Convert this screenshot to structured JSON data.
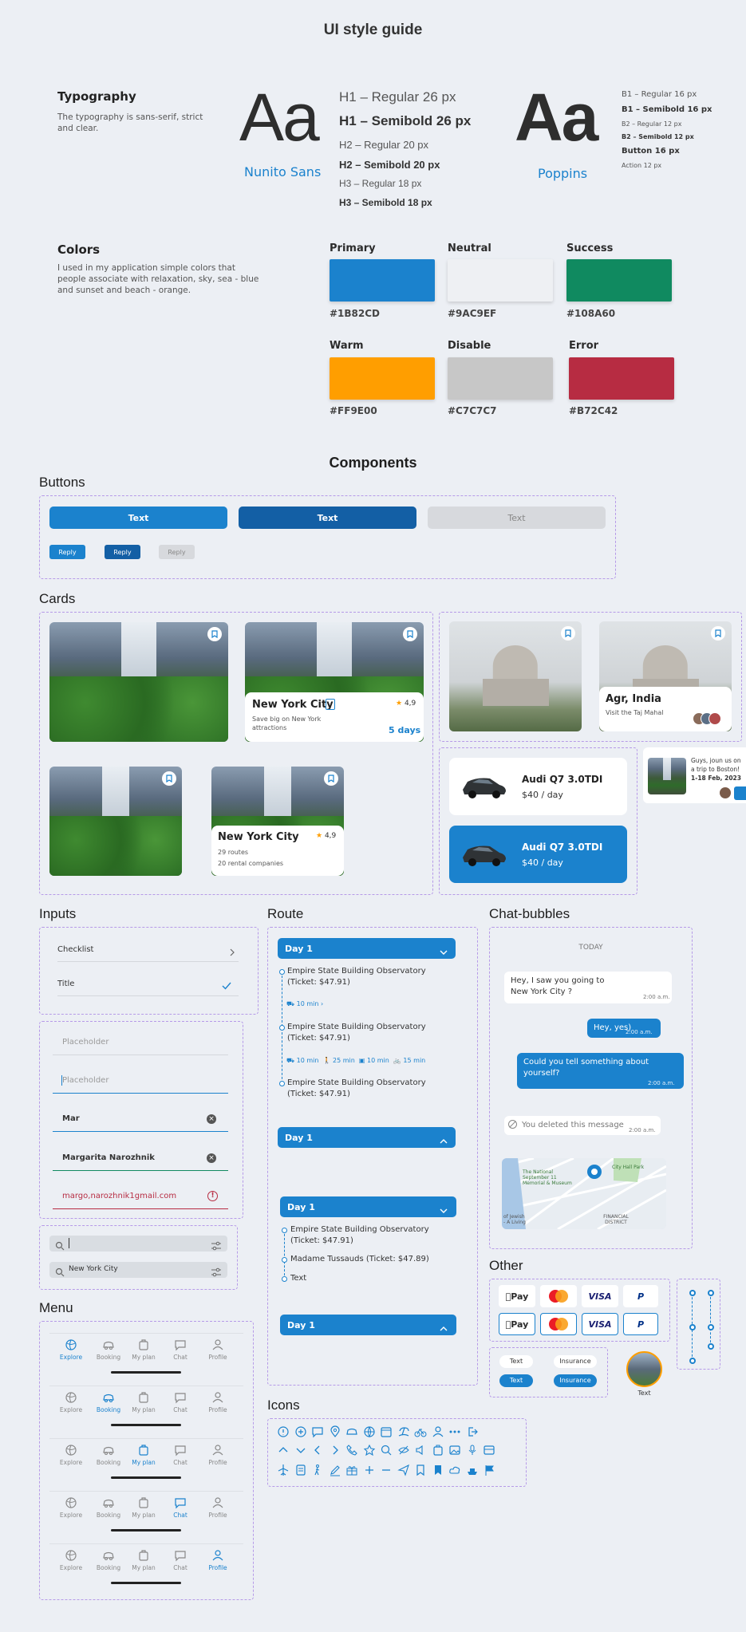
{
  "page_title": "UI style guide",
  "typography": {
    "heading": "Typography",
    "description": "The typography is sans-serif, strict and clear.",
    "sample": "Aa",
    "font1": {
      "name": "Nunito Sans",
      "styles": [
        "H1 – Regular 26 px",
        "H1 – Semibold 26 px",
        "H2 – Regular 20 px",
        "H2 – Semibold 20 px",
        "H3 – Regular 18 px",
        "H3 – Semibold 18 px"
      ]
    },
    "font2": {
      "name": "Poppins",
      "styles": [
        "B1 – Regular 16 px",
        "B1 – Semibold 16 px",
        "B2 – Regular 12 px",
        "B2 – Semibold 12 px",
        "Button 16 px",
        "Action 12 px"
      ]
    }
  },
  "colors": {
    "heading": "Colors",
    "description": "I used in my application simple colors that people associate with relaxation, sky, sea - blue and sunset and beach - orange.",
    "swatches": [
      {
        "label": "Primary",
        "hex": "#1B82CD"
      },
      {
        "label": "Neutral",
        "hex": "#9AC9EF"
      },
      {
        "label": "Success",
        "hex": "#108A60"
      },
      {
        "label": "Warm",
        "hex": "#FF9E00"
      },
      {
        "label": "Disable",
        "hex": "#C7C7C7"
      },
      {
        "label": "Error",
        "hex": "#B72C42"
      }
    ]
  },
  "components_heading": "Components",
  "buttons": {
    "heading": "Buttons",
    "large": [
      "Text",
      "Text",
      "Text"
    ],
    "small": [
      "Reply",
      "Reply",
      "Reply"
    ]
  },
  "cards": {
    "heading": "Cards",
    "nyc1": {
      "title": "New York City",
      "desc": "Save big on New York attractions",
      "rating": "4,9",
      "days": "5 days"
    },
    "nyc2": {
      "title": "New York City",
      "line1": "29 routes",
      "line2": "20 rental companies",
      "rating": "4,9"
    },
    "india": {
      "title": "Agr, India",
      "desc": "Visit the Taj Mahal"
    },
    "car1": {
      "title": "Audi Q7 3.0TDI",
      "price": "$40 / day"
    },
    "car2": {
      "title": "Audi Q7 3.0TDI",
      "price": "$40 / day"
    },
    "boston": {
      "text": "Guys, joun us on a trip to Boston!",
      "date": "1-18 Feb, 2023"
    }
  },
  "inputs": {
    "heading": "Inputs",
    "checklist": "Checklist",
    "title": "Title",
    "placeholder1": "Placeholder",
    "placeholder2": "Placeholder",
    "typing": "Mar",
    "filled": "Margarita Narozhnik",
    "error": "margo,narozhnik1gmail.com",
    "search_value": "New York City"
  },
  "route": {
    "heading": "Route",
    "day_label": "Day 1",
    "place1": "Empire State Building Observatory (Ticket: $47.91)",
    "place2": "Empire State Building Observatory (Ticket: $47.91)",
    "place3": "Empire State Building Observatory (Ticket: $47.91)",
    "t10": "10 min",
    "t25": "25 min",
    "t10b": "10 min",
    "t15": "15 min",
    "t10c": "10 min",
    "d3place1": "Empire State Building Observatory (Ticket: $47.91)",
    "d3place2": "Madame Tussauds (Ticket: $47.89)",
    "d3place3": "Text"
  },
  "chat": {
    "heading": "Chat-bubbles",
    "today": "TODAY",
    "m1": "Hey, I saw you going to New York City ?",
    "m1_time": "2:00 a.m.",
    "m2": "Hey, yes)",
    "m2_time": "2:00 a.m.",
    "m3": "Could you tell something about yourself?",
    "m3_time": "2:00 a.m.",
    "m4": "You deleted this message",
    "m4_time": "2:00 a.m."
  },
  "map_labels": {
    "a": "The National September 11 Memorial & Museum",
    "b": "City Hall Park",
    "c": "FINANCIAL DISTRICT",
    "d": "of Jewish - A Living"
  },
  "other": {
    "heading": "Other",
    "chip1": "Text",
    "chip2": "Insurance",
    "chip3": "Text",
    "chip4": "Insurance",
    "avatar_label": "Text",
    "pay": [
      "Pay",
      "VISA",
      "P"
    ]
  },
  "menu": {
    "heading": "Menu",
    "items": [
      "Explore",
      "Booking",
      "My plan",
      "Chat",
      "Profile"
    ]
  },
  "icons_heading": "Icons",
  "palette": {
    "primary": "#1B82CD",
    "dark_primary": "#135FA5",
    "disable": "#C7C7C7",
    "error": "#B72C42",
    "warm": "#FF9E00"
  }
}
